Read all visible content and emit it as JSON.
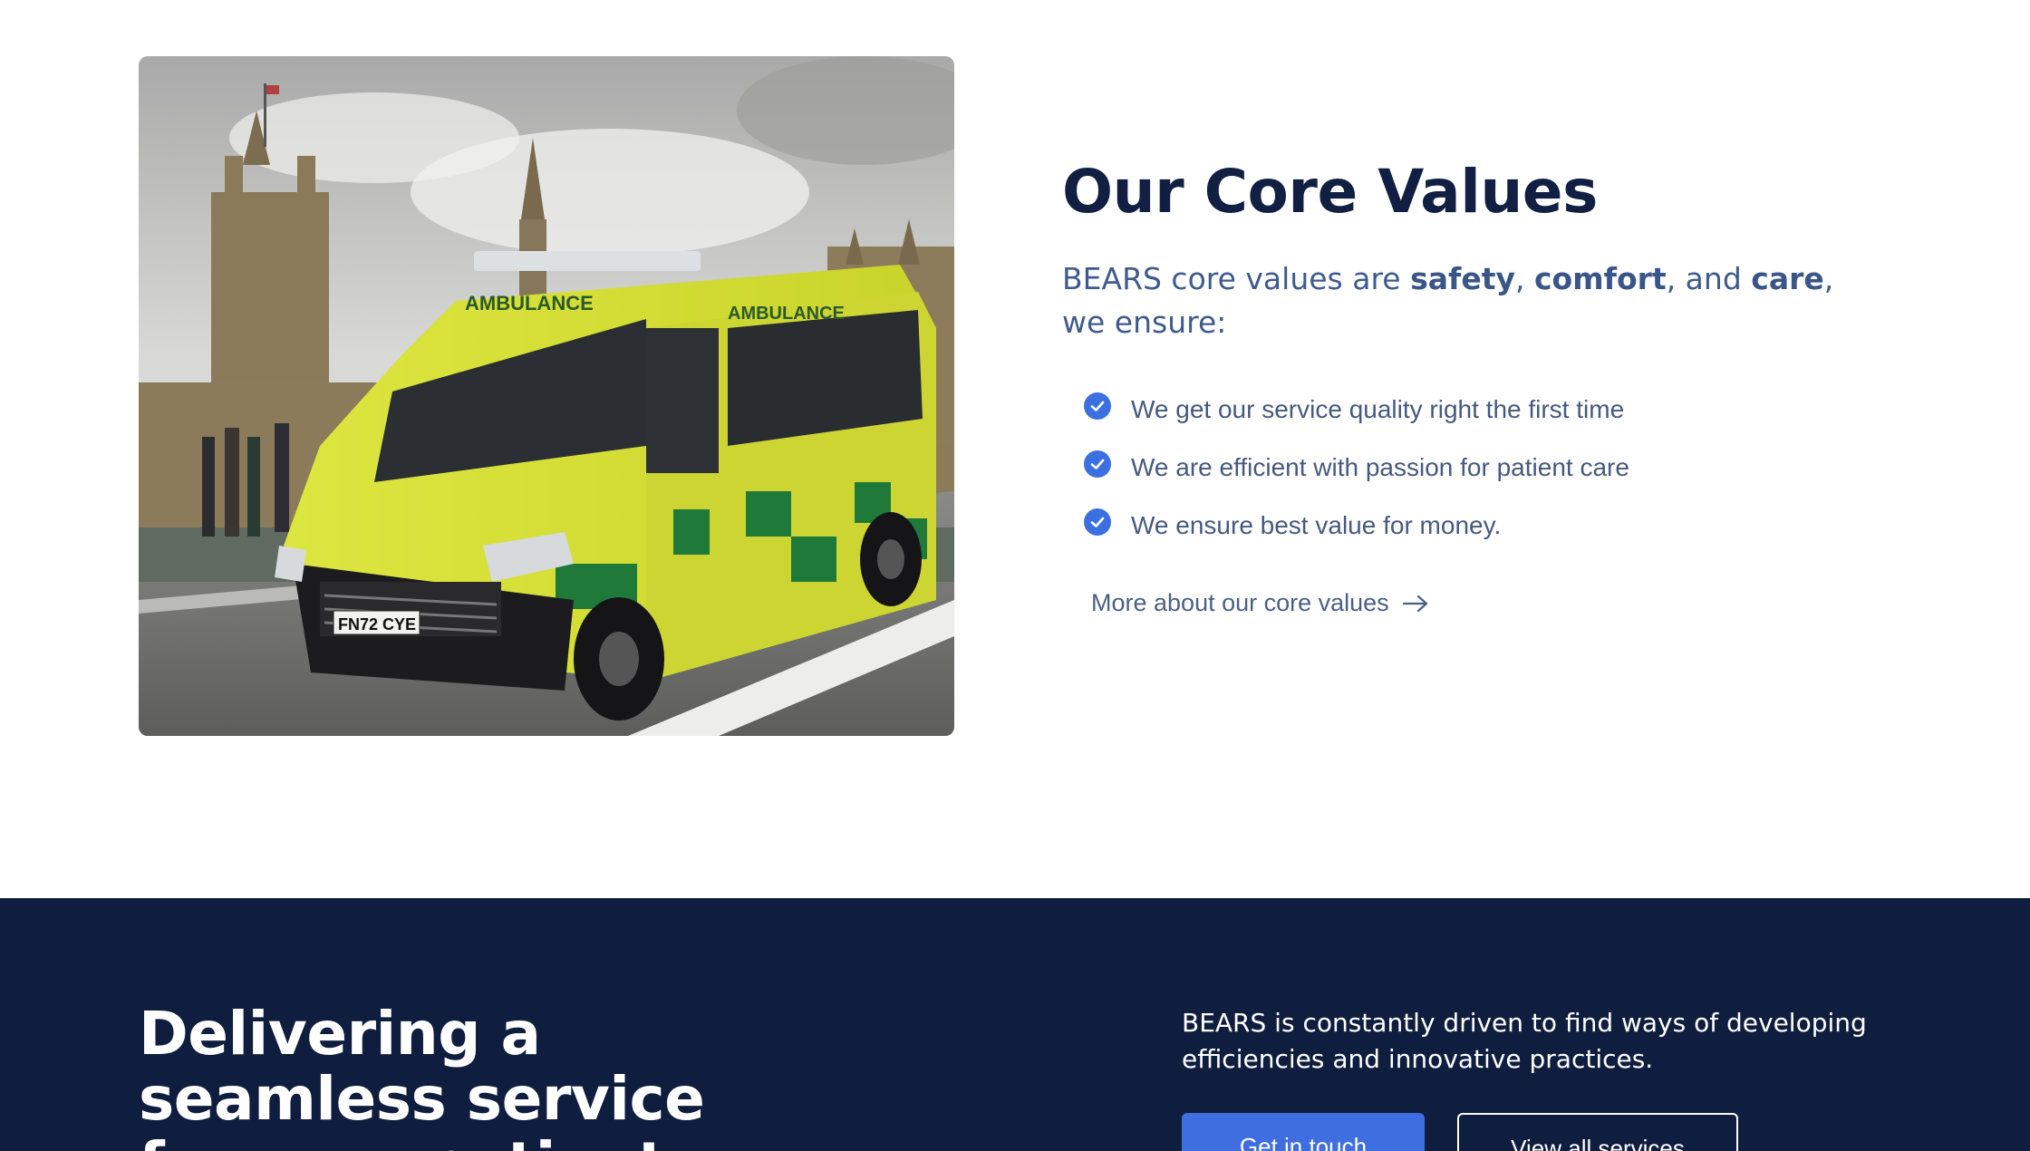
{
  "core_values": {
    "image_alt": "Ambulance on Westminster Bridge",
    "title": "Our Core Values",
    "intro": {
      "prefix": "BEARS core values are ",
      "value_1": "safety",
      "sep_1": ", ",
      "value_2": "comfort",
      "sep_2": ", and ",
      "value_3": "care",
      "suffix": ", we ensure:"
    },
    "items": [
      {
        "text": "We get our service quality right the first time",
        "icon": "check-circle-icon"
      },
      {
        "text": "We are efficient with passion for patient care",
        "icon": "check-circle-icon"
      },
      {
        "text": "We ensure best value for money.",
        "icon": "check-circle-icon"
      }
    ],
    "link_label": "More about our core values",
    "link_icon": "arrow-right-icon"
  },
  "cta": {
    "heading": "Delivering a seamless service for your patients",
    "description": "BEARS is constantly driven to find ways of developing efficiencies and innovative practices.",
    "primary_button": "Get in touch",
    "secondary_button": "View all services"
  },
  "colors": {
    "navy": "#0f1d3f",
    "accent_blue": "#3f6ee0",
    "text_muted": "#46597e"
  }
}
